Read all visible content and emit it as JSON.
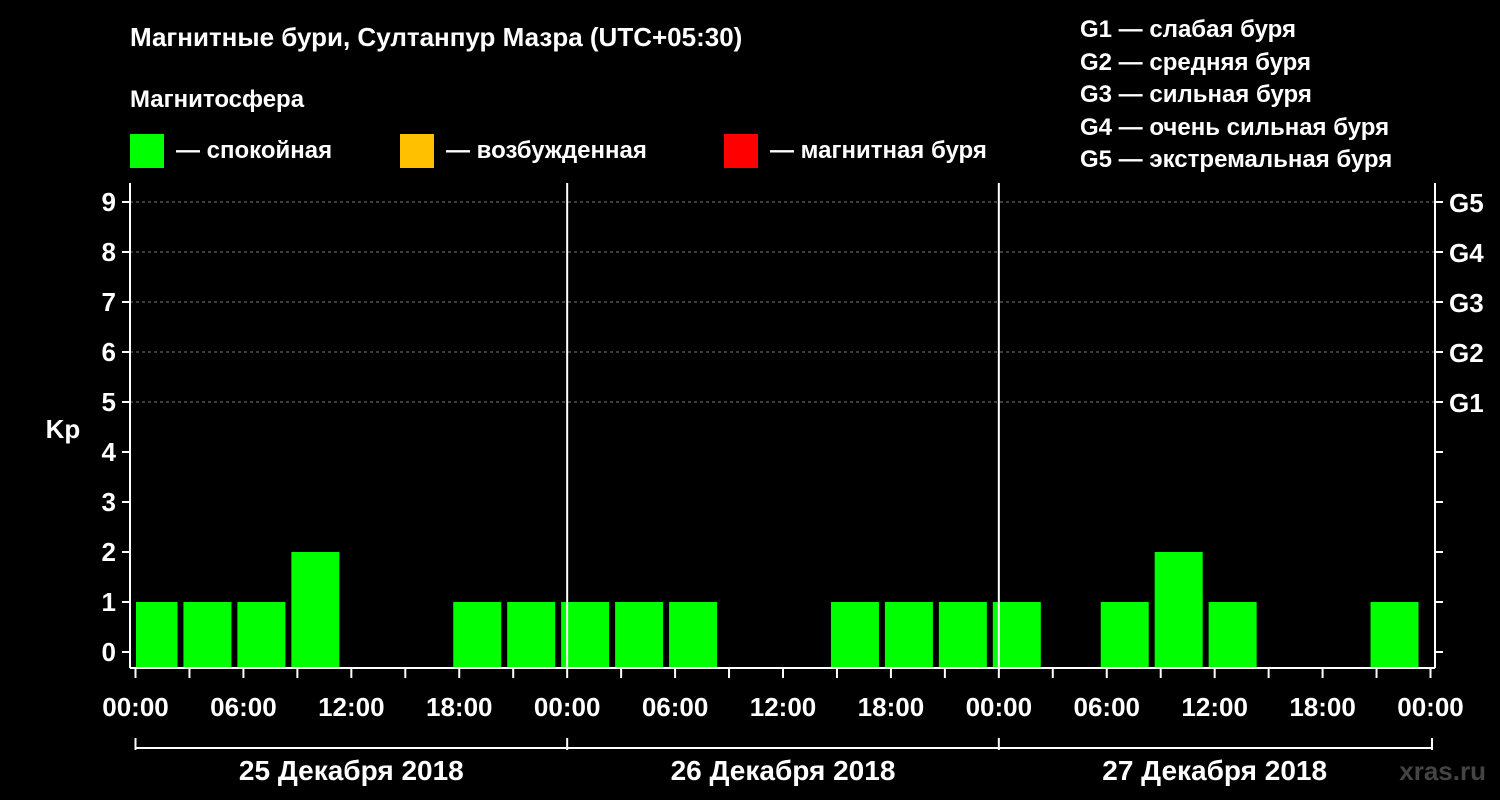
{
  "title": "Магнитные бури, Султанпур Мазра (UTC+05:30)",
  "magnetosphere_title": "Магнитосфера",
  "legend": [
    {
      "label": "— спокойная",
      "color": "#00ff00"
    },
    {
      "label": "— возбужденная",
      "color": "#ffc000"
    },
    {
      "label": "— магнитная буря",
      "color": "#ff0000"
    }
  ],
  "g_scale": [
    "G1 — слабая буря",
    "G2 — средняя буря",
    "G3 — сильная буря",
    "G4 — очень сильная буря",
    "G5 — экстремальная буря"
  ],
  "watermark": "xras.ru",
  "chart_data": {
    "type": "bar",
    "ylabel": "Kp",
    "ylim": [
      0,
      9
    ],
    "y_ticks": [
      "0",
      "1",
      "2",
      "3",
      "4",
      "5",
      "6",
      "7",
      "8",
      "9"
    ],
    "right_axis_labels": [
      {
        "kp": 5,
        "label": "G1"
      },
      {
        "kp": 6,
        "label": "G2"
      },
      {
        "kp": 7,
        "label": "G3"
      },
      {
        "kp": 8,
        "label": "G4"
      },
      {
        "kp": 9,
        "label": "G5"
      }
    ],
    "x_tick_labels": [
      "00:00",
      "06:00",
      "12:00",
      "18:00",
      "00:00",
      "06:00",
      "12:00",
      "18:00",
      "00:00",
      "06:00",
      "12:00",
      "18:00",
      "00:00"
    ],
    "days": [
      "25 Декабря 2018",
      "26 Декабря 2018",
      "27 Декабря 2018"
    ],
    "grid": "dashed horizontal lines at Kp 5-9",
    "bar_color": "#00ff00",
    "series": [
      {
        "values": [
          1,
          1,
          1,
          2,
          0,
          0,
          1,
          1,
          1,
          1,
          1,
          0,
          0,
          1,
          1,
          1,
          1,
          0,
          1,
          2,
          1,
          0,
          0,
          1
        ]
      }
    ],
    "bars_start_hour": -0.5,
    "bar_interval_hours": 3
  }
}
